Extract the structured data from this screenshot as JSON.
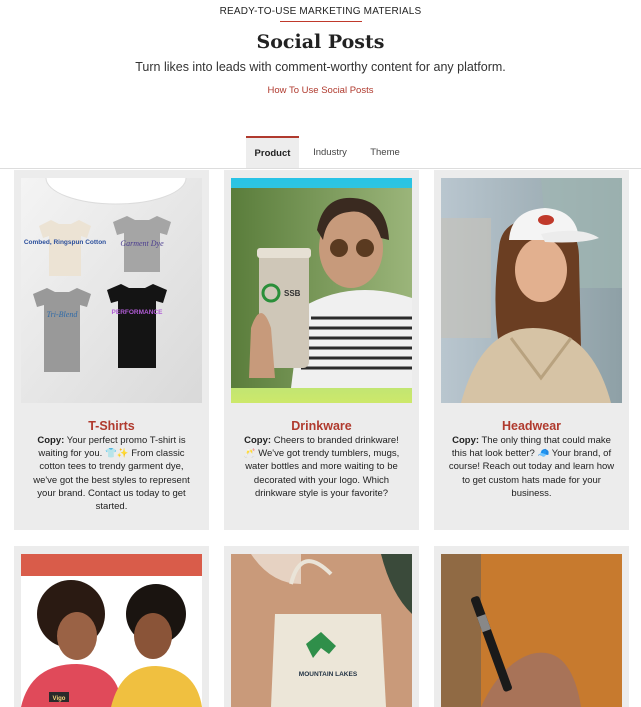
{
  "header": {
    "eyebrow": "READY-TO-USE MARKETING MATERIALS",
    "title": "Social Posts",
    "subtitle": "Turn likes into leads with comment-worthy content for any platform.",
    "link": "How To Use Social Posts"
  },
  "tabs": [
    {
      "label": "Product",
      "active": true
    },
    {
      "label": "Industry",
      "active": false
    },
    {
      "label": "Theme",
      "active": false
    }
  ],
  "cards": [
    {
      "title": "T-Shirts",
      "copy_label": "Copy:",
      "copy": "Your perfect promo T-shirt is waiting for you. 👕✨ From classic cotton tees to trendy garment dye, we've got the best styles to represent your brand. Contact us today to get started.",
      "shirt_labels": [
        "Combed, Ringspun Cotton",
        "Garment Dye",
        "Tri-Blend",
        "PERFORMANCE"
      ]
    },
    {
      "title": "Drinkware",
      "copy_label": "Copy:",
      "copy": "Cheers to branded drinkware! 🥂 We've got trendy tumblers, mugs, water bottles and more waiting to be decorated with your logo. Which drinkware style is your favorite?",
      "logo_text": "SSB"
    },
    {
      "title": "Headwear",
      "copy_label": "Copy:",
      "copy": "The only thing that could make this hat look better? 🧢 Your brand, of course! Reach out today and learn how to get custom hats made for your business."
    },
    {
      "badge": "Vigo"
    },
    {
      "bag_text": "MOUNTAIN LAKES"
    },
    {}
  ],
  "colors": {
    "accent": "#b03a2e",
    "card_bg": "#ececec"
  }
}
